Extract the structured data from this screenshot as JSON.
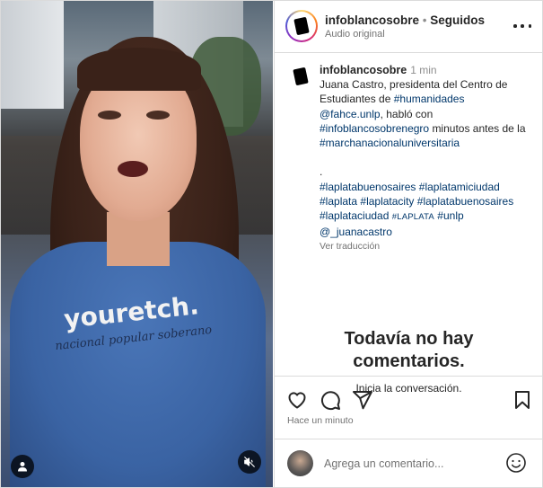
{
  "media": {
    "shirt_text": "youretch.",
    "shirt_subtext": "nacional popular soberano"
  },
  "header": {
    "username": "infoblancosobre",
    "separator": "•",
    "follow_status": "Seguidos",
    "audio": "Audio original"
  },
  "caption": {
    "username": "infoblancosobre",
    "time": "1 min",
    "line1": "Juana Castro, presidenta del Centro de Estudiantes de",
    "tag_humanidades": "#humanidades",
    "mention_fahce": "@fahce.unlp",
    "text_hablo": ", habló con",
    "tag_infoblanco": "#infoblancosobrenegro",
    "text_minutos": "minutos antes de la",
    "tag_marcha": "#marchanacionaluniversitaria",
    "dot": ".",
    "tags_row1": [
      "#laplatabuenosaires",
      "#laplatamiciudad"
    ],
    "tags_row2": [
      "#laplata",
      "#laplatacity",
      "#laplatabuenosaires"
    ],
    "tags_row3": [
      "#laplataciudad",
      "#LAPLATA",
      "#unlp"
    ],
    "mention_juana": "@_juanacastro",
    "translate": "Ver traducción"
  },
  "comments": {
    "empty_title_1": "Todavía no hay",
    "empty_title_2": "comentarios.",
    "empty_sub": "Inicia la conversación."
  },
  "actions": {
    "timestamp": "Hace un minuto"
  },
  "compose": {
    "placeholder": "Agrega un comentario..."
  },
  "colors": {
    "link": "#00376b",
    "text": "#262626",
    "muted": "#737373",
    "divider": "#dbdbdb"
  },
  "icons": [
    "user-icon",
    "mute-icon",
    "more-icon",
    "heart-icon",
    "comment-icon",
    "share-icon",
    "bookmark-icon",
    "emoji-icon"
  ]
}
